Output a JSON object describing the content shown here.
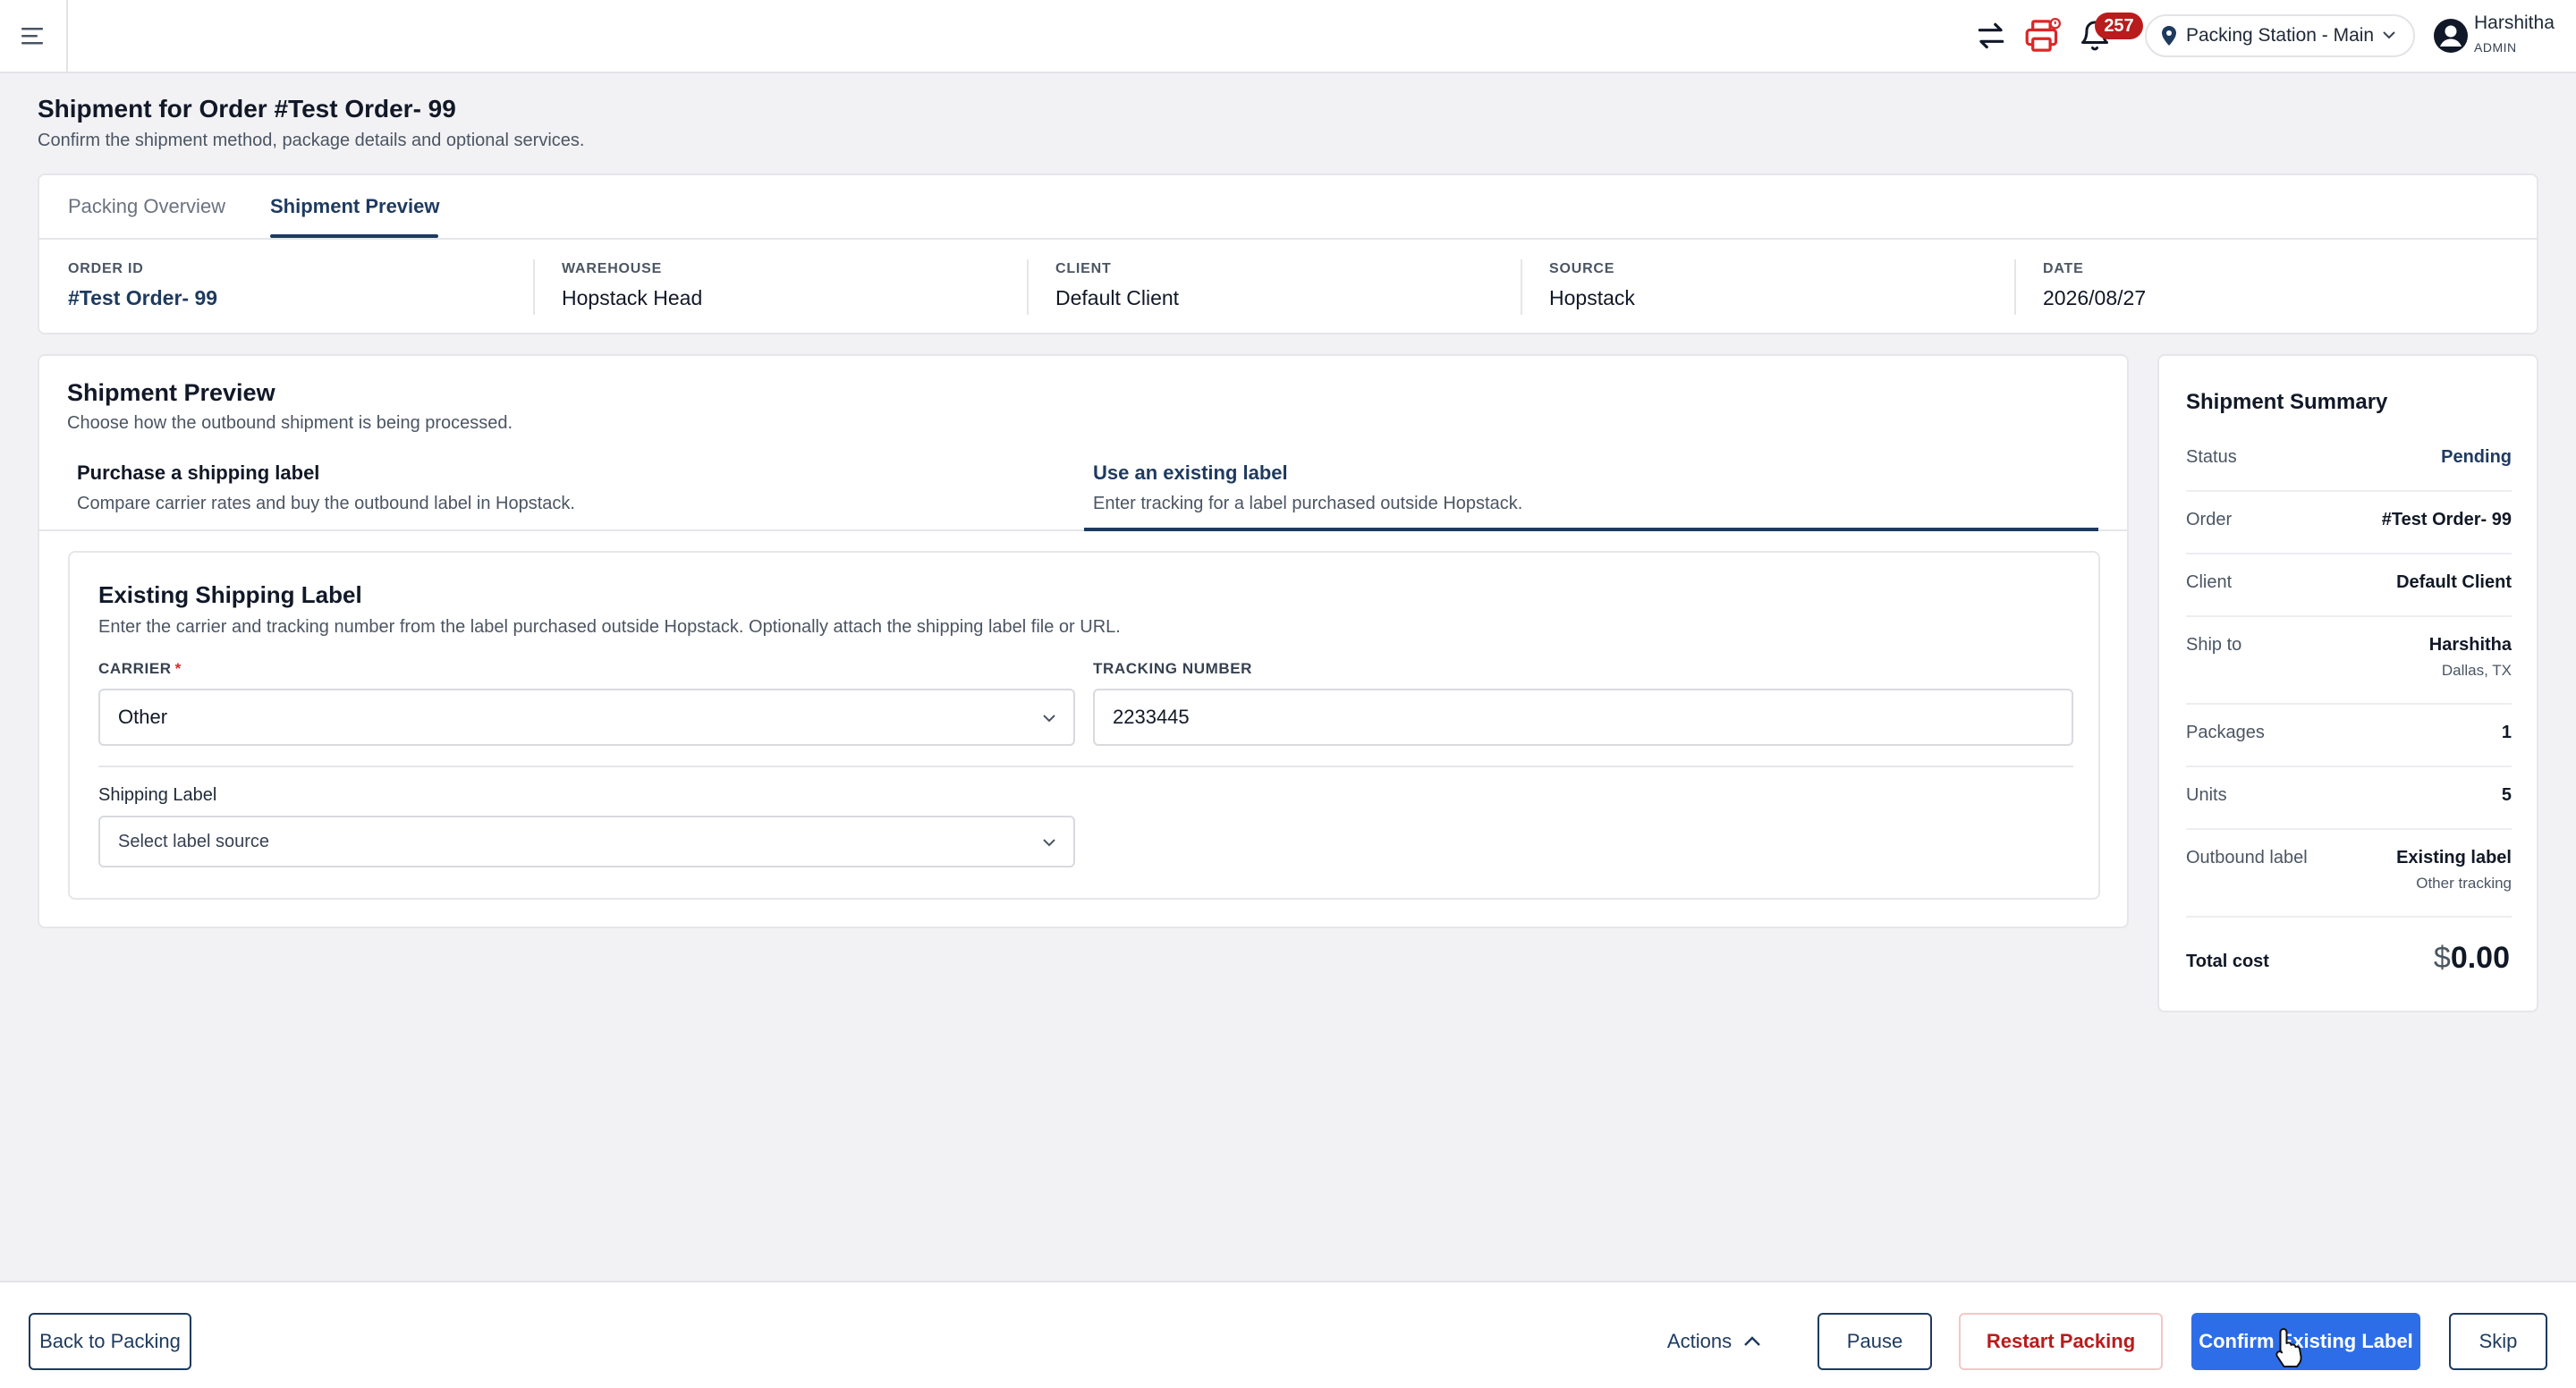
{
  "topbar": {
    "notification_count": "257",
    "station": {
      "label": "Packing Station - Main"
    },
    "user": {
      "name": "Harshitha",
      "role": "ADMIN"
    }
  },
  "page": {
    "title": "Shipment for Order #Test Order- 99",
    "subtitle": "Confirm the shipment method, package details and optional services."
  },
  "tabs": [
    {
      "label": "Packing Overview",
      "active": false
    },
    {
      "label": "Shipment Preview",
      "active": true
    }
  ],
  "overview": [
    {
      "label": "ORDER ID",
      "value": "#Test Order- 99"
    },
    {
      "label": "WAREHOUSE",
      "value": "Hopstack Head"
    },
    {
      "label": "CLIENT",
      "value": "Default Client"
    },
    {
      "label": "SOURCE",
      "value": "Hopstack"
    },
    {
      "label": "DATE",
      "value": "2026/08/27"
    }
  ],
  "preview": {
    "title": "Shipment Preview",
    "subtitle": "Choose how the outbound shipment is being processed.",
    "options": [
      {
        "title": "Purchase a shipping label",
        "desc": "Compare carrier rates and buy the outbound label in Hopstack.",
        "active": false
      },
      {
        "title": "Use an existing label",
        "desc": "Enter tracking for a label purchased outside Hopstack.",
        "active": true
      }
    ]
  },
  "existing_label": {
    "title": "Existing Shipping Label",
    "subtitle": "Enter the carrier and tracking number from the label purchased outside Hopstack. Optionally attach the shipping label file or URL.",
    "carrier_label": "CARRIER",
    "carrier_required_mark": "*",
    "carrier_value": "Other",
    "tracking_label": "TRACKING NUMBER",
    "tracking_value": "2233445",
    "shipping_label_label": "Shipping Label",
    "shipping_label_placeholder": "Select label source"
  },
  "summary": {
    "title": "Shipment Summary",
    "rows": [
      {
        "label": "Status",
        "value": "Pending"
      },
      {
        "label": "Order",
        "value": "#Test Order- 99"
      },
      {
        "label": "Client",
        "value": "Default Client"
      },
      {
        "label": "Ship to",
        "value": "Harshitha",
        "sub": "Dallas, TX"
      },
      {
        "label": "Packages",
        "value": "1"
      },
      {
        "label": "Units",
        "value": "5"
      },
      {
        "label": "Outbound label",
        "value": "Existing label",
        "sub": "Other tracking"
      }
    ],
    "total_label": "Total cost",
    "total_currency": "$",
    "total_amount": "0.00"
  },
  "actions": {
    "back": "Back to Packing",
    "menu": "Actions",
    "pause": "Pause",
    "restart": "Restart Packing",
    "confirm": "Confirm Existing Label",
    "skip": "Skip"
  },
  "colors": {
    "primary": "#2d6ee8",
    "navy": "#1e3a5f",
    "danger": "#b91c1c",
    "background": "#f2f2f4"
  }
}
